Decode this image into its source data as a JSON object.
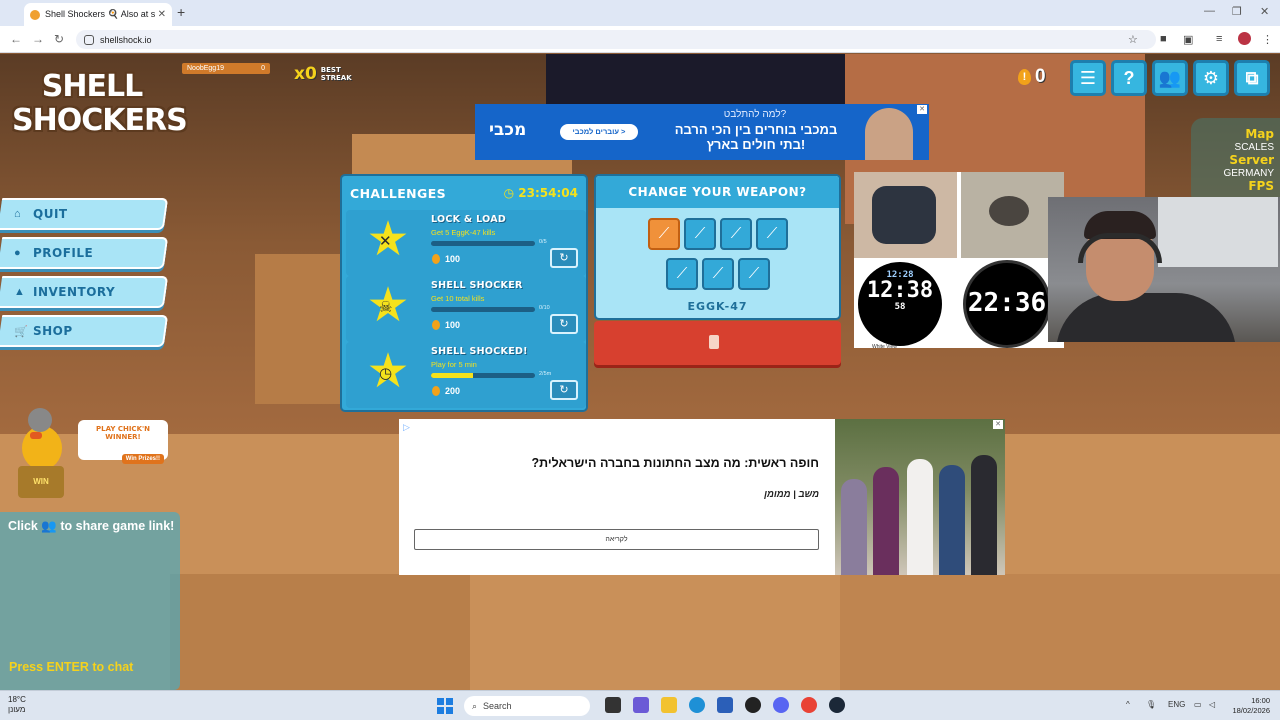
{
  "browser": {
    "tab_title": "Shell Shockers 🍳 Also at shellshock.io",
    "url": "shellshock.io",
    "new_tab": "+",
    "tab_close": "✕"
  },
  "game": {
    "logo_line1": "SHELL",
    "logo_line2": "SHOCKERS",
    "player_name": "NoobEgg19",
    "player_score": "0",
    "streak_mult": "x0",
    "streak_label_1": "BEST",
    "streak_label_2": "STREAK",
    "coins": "0",
    "map_label": "Map",
    "map_value": "SCALES",
    "server_label": "Server",
    "server_value": "GERMANY",
    "fps_label": "FPS",
    "menu": [
      {
        "icon": "home-icon",
        "label": "QUIT"
      },
      {
        "icon": "user-icon",
        "label": "PROFILE"
      },
      {
        "icon": "hat-icon",
        "label": "INVENTORY"
      },
      {
        "icon": "cart-icon",
        "label": "SHOP"
      }
    ],
    "chick_bubble": "PLAY CHICK'N WINNER!",
    "chick_button": "Win Prizes!!",
    "chick_sign": "WIN",
    "share_text": "Click 👥 to share game link!",
    "chat_hint": "Press ENTER to chat"
  },
  "challenges": {
    "title": "CHALLENGES",
    "timer": "23:54:04",
    "items": [
      {
        "name": "LOCK & LOAD",
        "desc": "Get 5 EggK-47 kills",
        "progress": 0,
        "count": "0/5",
        "reward": "100"
      },
      {
        "name": "SHELL SHOCKER",
        "desc": "Get 10 total kills",
        "progress": 0,
        "count": "0/10",
        "reward": "100"
      },
      {
        "name": "SHELL SHOCKED!",
        "desc": "Play for 5 min",
        "progress": 0.4,
        "count": "2/5m",
        "reward": "200"
      }
    ]
  },
  "weapon": {
    "title": "CHANGE YOUR WEAPON?",
    "selected": "EGGK-47"
  },
  "ads": {
    "top_brand": "מכבי",
    "top_cta": "עוברים למכבי >",
    "top_question": "למה להתלבט?",
    "top_line1": "במכבי בוחרים בין הכי הרבה",
    "top_line2": "בתי חולים בארץ!",
    "mid_headline": "חופה ראשית: מה מצב החתונות בחברה הישראלית?",
    "mid_source": "משב | ממומן",
    "mid_button": "לקריאה",
    "clock1_top": "12:28",
    "clock1_main": "12:38",
    "clock1_sec": "58",
    "clock2_main": "22:36",
    "clock_caption": "White View"
  },
  "taskbar": {
    "temp": "18°C",
    "weather": "מעונן",
    "search": "Search",
    "lang": "ENG",
    "time": "16:00",
    "date": "18/02/2026"
  }
}
